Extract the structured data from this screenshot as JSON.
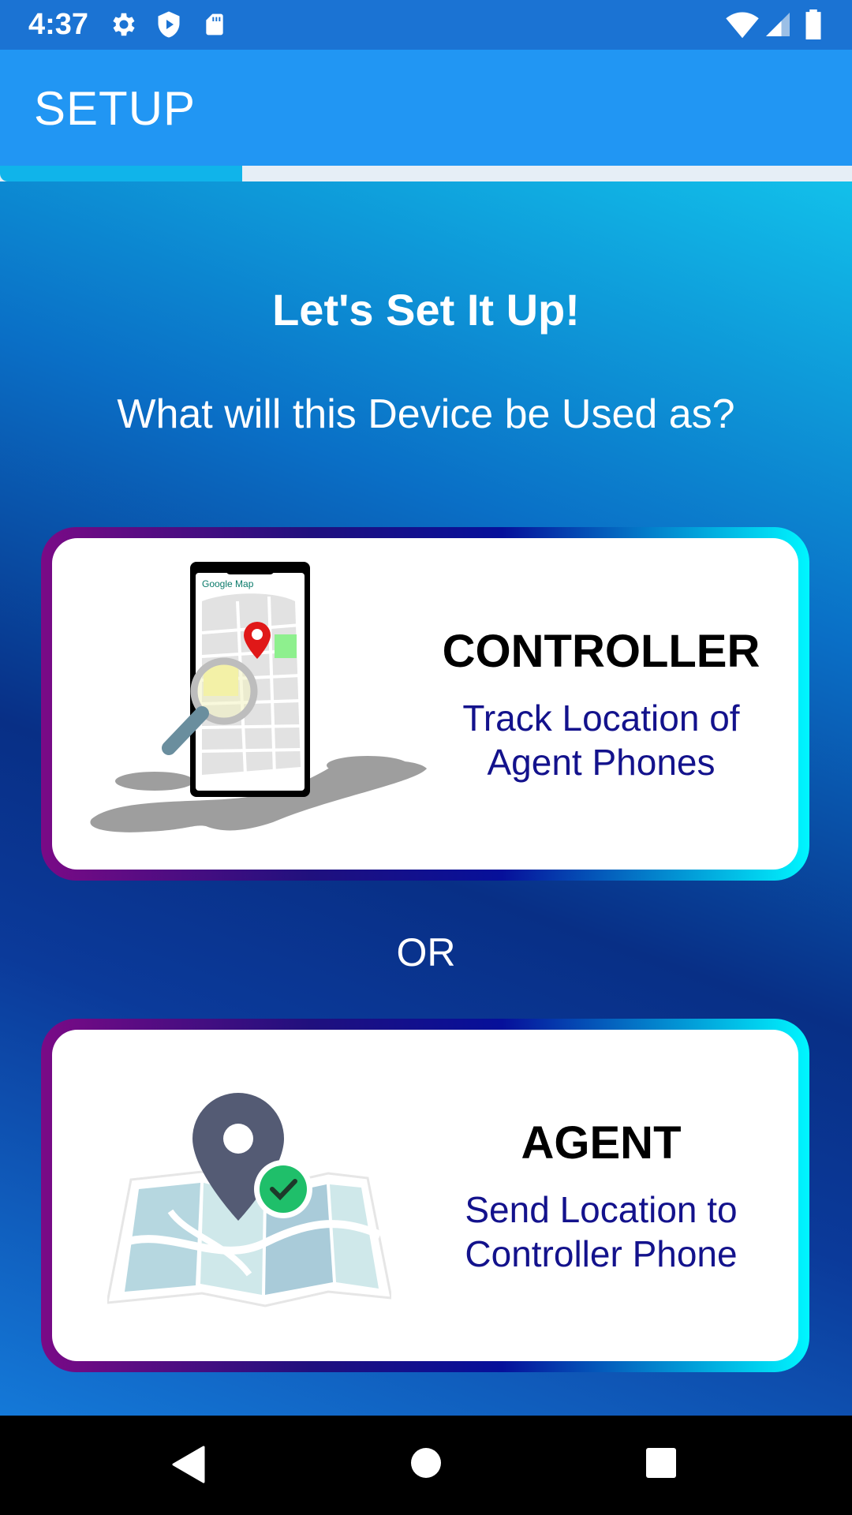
{
  "status_bar": {
    "time": "4:37",
    "icons": [
      "gear-icon",
      "shield-play-icon",
      "sd-card-icon",
      "wifi-icon",
      "signal-icon",
      "battery-icon"
    ]
  },
  "app_bar": {
    "title": "SETUP"
  },
  "progress": {
    "value": 0.284,
    "fill_color": "#10b4ea",
    "track_color": "#e6eef6"
  },
  "main": {
    "heading": "Let's Set It Up!",
    "subheading": "What will this Device be Used as?",
    "or_label": "OR"
  },
  "cards": [
    {
      "title": "CONTROLLER",
      "desc_line1": "Track Location of",
      "desc_line2": "Agent Phones",
      "illustration": "phone-map-search-illustration",
      "map_label": "Google Map"
    },
    {
      "title": "AGENT",
      "desc_line1": "Send Location to",
      "desc_line2": "Controller Phone",
      "illustration": "map-pin-check-illustration"
    }
  ],
  "nav_bar": {
    "buttons": [
      "back-icon",
      "home-icon",
      "recents-icon"
    ]
  },
  "colors": {
    "status_bar": "#1b73d3",
    "app_bar": "#2196f3",
    "card_desc": "#13128c",
    "nav_bar": "#000000"
  }
}
